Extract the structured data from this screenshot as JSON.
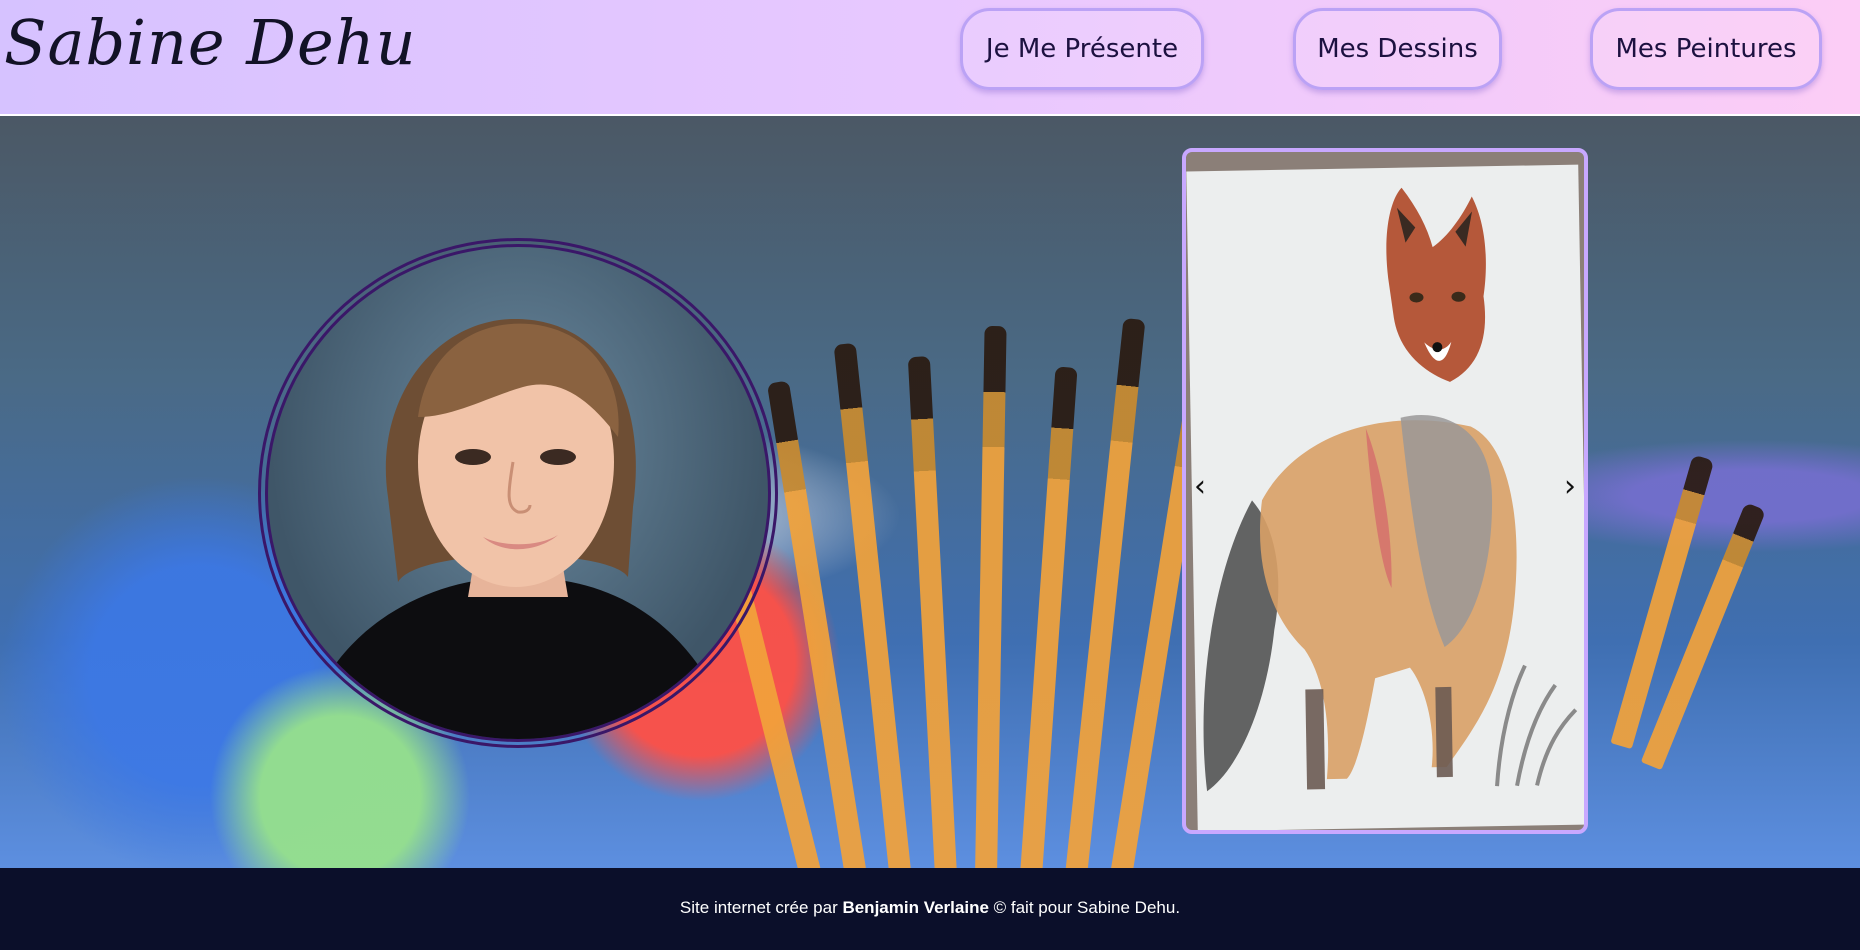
{
  "header": {
    "logo_text": "Sabine Dehu",
    "nav": [
      {
        "label": "Je Me Présente"
      },
      {
        "label": "Mes Dessins"
      },
      {
        "label": "Mes Peintures"
      }
    ]
  },
  "hero": {
    "portrait_alt": "photo de Sabine Dehu",
    "carousel": {
      "prev_symbol": "‹",
      "next_symbol": "›",
      "artwork": "fox-watercolor"
    }
  },
  "footer": {
    "prefix": "Site internet crée par ",
    "author": "Benjamin Verlaine",
    "suffix": " © fait pour Sabine Dehu."
  },
  "colors": {
    "header_gradient_start": "#d6c2ff",
    "header_gradient_end": "#fccdf6",
    "nav_border": "#bba2f5",
    "ring": "#3a1768",
    "carousel_border": "#c8a8ff",
    "footer_bg": "#0b0f2a"
  }
}
